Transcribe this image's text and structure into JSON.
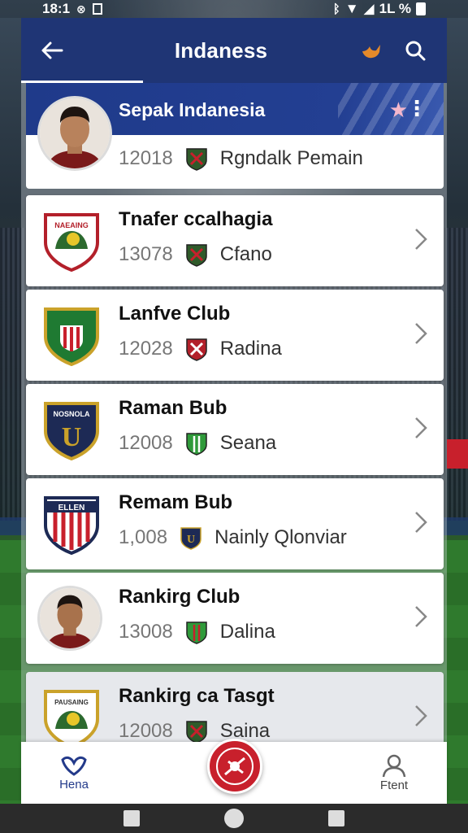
{
  "status_bar": {
    "time": "18:1",
    "battery": "1L %"
  },
  "app_bar": {
    "title": "Indaness"
  },
  "header": {
    "name": "Sepak Indanesia",
    "number": "12018",
    "subtitle": "Rgndalk Pemain"
  },
  "clubs": [
    {
      "name": "Tnafer ccalhagia",
      "number": "13078",
      "subtitle": "Cfano",
      "logo_text": "NAEAING"
    },
    {
      "name": "Lanfve Club",
      "number": "12028",
      "subtitle": "Radina",
      "logo_text": ""
    },
    {
      "name": "Raman Bub",
      "number": "12008",
      "subtitle": "Seana",
      "logo_text": "NOSNOLA"
    },
    {
      "name": "Remam Bub",
      "number": "1,008",
      "subtitle": "Nainly Qlonviar",
      "logo_text": "ELLEN"
    },
    {
      "name": "Rankirg Club",
      "number": "13008",
      "subtitle": "Dalina",
      "logo_text": ""
    },
    {
      "name": "Rankirg ca Tasgt",
      "number": "12008",
      "subtitle": "Saina",
      "logo_text": "PAUSAING"
    }
  ],
  "bottom_nav": {
    "home_label": "Hena",
    "profile_label": "Ftent"
  },
  "colors": {
    "primary": "#1f3575",
    "accent": "#c8202c"
  }
}
